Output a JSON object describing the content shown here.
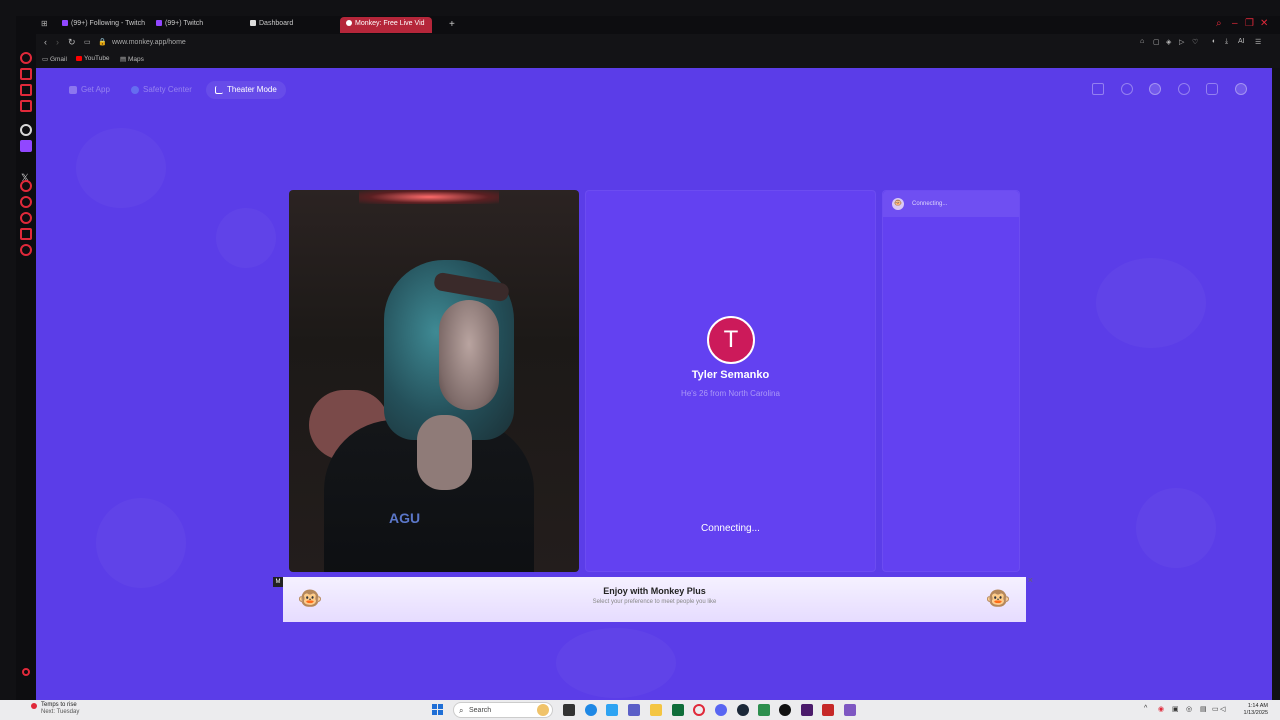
{
  "browser": {
    "tabs": [
      {
        "label": "(99+) Following - Twitch"
      },
      {
        "label": "(99+) Twitch"
      },
      {
        "label": "Dashboard"
      },
      {
        "label": "Monkey: Free Live Vid"
      }
    ],
    "url": "www.monkey.app/home",
    "ai_label": "AI",
    "bookmarks": [
      {
        "label": "Gmail"
      },
      {
        "label": "YouTube"
      },
      {
        "label": "Maps"
      }
    ]
  },
  "page": {
    "toolbar": {
      "get_app": "Get App",
      "safety_center": "Safety Center",
      "theater_mode": "Theater Mode"
    },
    "partner": {
      "initial": "T",
      "name": "Tyler Semanko",
      "subtitle": "He's 26 from North Carolina",
      "status": "Connecting..."
    },
    "self_video_text": "AGU",
    "chat": {
      "status": "Connecting..."
    },
    "banner": {
      "ad_mark": "M",
      "title": "Enjoy with Monkey Plus",
      "subtitle": "Select your preference to meet people you like"
    }
  },
  "taskbar": {
    "weather_title": "Temps to rise",
    "weather_sub": "Next: Tuesday",
    "search_placeholder": "Search",
    "time": "1:14 AM",
    "date": "1/13/2025"
  },
  "colors": {
    "page_bg": "#5b3de8",
    "panel_bg": "#6341f1",
    "avatar_bg": "#cc1a5a",
    "tab_active": "#b5263a",
    "opera_red": "#e0293a"
  }
}
